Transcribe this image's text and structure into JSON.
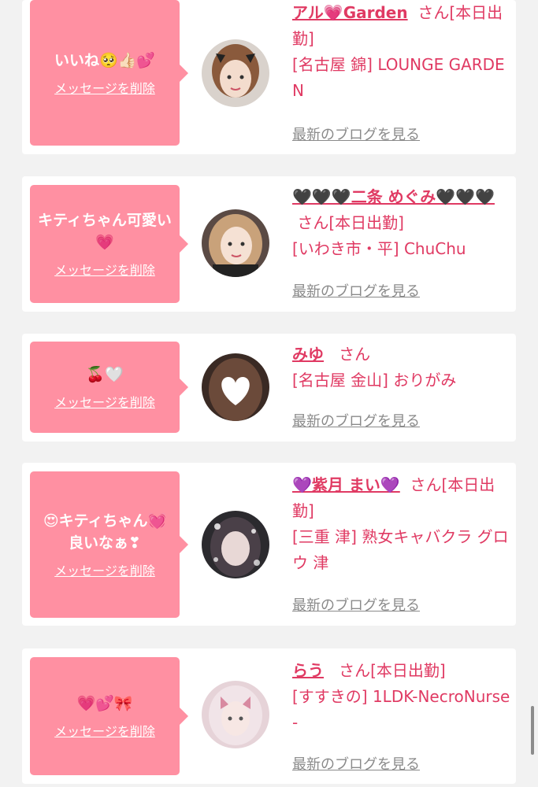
{
  "messages": [
    {
      "bubble_text": "いいね🥺👍🏻💕",
      "delete_label": "メッセージを削除",
      "cast_name": "アル💗Garden",
      "honorific": "さん",
      "status": "[本日出勤]",
      "shop": "[名古屋 錦] LOUNGE GARDEN",
      "blog_label": "最新のブログを見る"
    },
    {
      "bubble_text": "キティちゃん可愛い💗",
      "delete_label": "メッセージを削除",
      "cast_name": "🖤🖤🖤二条 めぐみ🖤🖤🖤",
      "honorific": "さん",
      "status": "[本日出勤]",
      "shop": "[いわき市・平] ChuChu",
      "blog_label": "最新のブログを見る"
    },
    {
      "bubble_text": "🍒🤍",
      "delete_label": "メッセージを削除",
      "cast_name": "みゆ",
      "honorific": "さん",
      "status": "",
      "shop": "[名古屋 金山] おりがみ",
      "blog_label": "最新のブログを見る"
    },
    {
      "bubble_text": "😍キティちゃん💓良いなぁ❣",
      "delete_label": "メッセージを削除",
      "cast_name": "💜紫月 まい💜",
      "honorific": "さん",
      "status": "[本日出勤]",
      "shop": "[三重 津] 熟女キャバクラ グロウ 津",
      "blog_label": "最新のブログを見る"
    },
    {
      "bubble_text": "💗💕🎀",
      "delete_label": "メッセージを削除",
      "cast_name": "らう",
      "honorific": "さん",
      "status": "[本日出勤]",
      "shop": "[すすきの] 1LDK-NecroNurse-",
      "blog_label": "最新のブログを見る"
    }
  ],
  "colors": {
    "page_bg": "#f2f2f2",
    "card_bg": "#ffffff",
    "bubble_bg": "#ff90a2",
    "name_pink": "#e03a63",
    "link_gray": "#8a8a8a"
  }
}
